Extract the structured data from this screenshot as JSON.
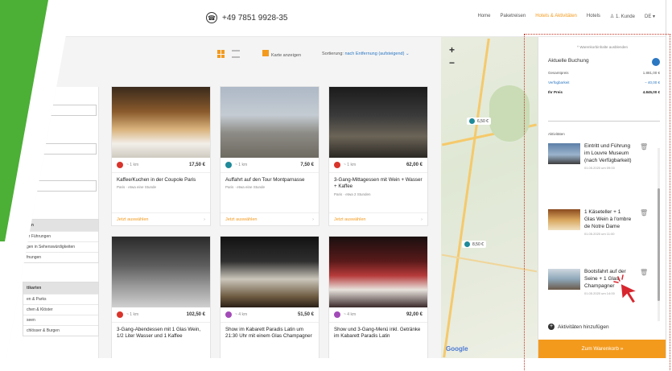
{
  "topbar": {
    "phone": "+49 7851 9928-35",
    "nav": [
      {
        "label": "Home",
        "active": false
      },
      {
        "label": "Paketreisen",
        "active": false
      },
      {
        "label": "Hotels & Aktivitäten",
        "active": true
      },
      {
        "label": "Hotels",
        "active": false
      },
      {
        "label": "1. Kunde",
        "active": false
      },
      {
        "label": "DE ▾",
        "active": false
      }
    ]
  },
  "toolbar": {
    "map_toggle": "Karte anzeigen",
    "sort_label": "Sortierung:",
    "sort_value": "nach Entfernung (aufsteigend) ⌄"
  },
  "sidebar": {
    "section1": {
      "header": "gen",
      "rows": [
        "er Führungen",
        "gen in Sehenswürdigkeiten",
        "fnungen"
      ]
    },
    "section2": {
      "header": "ttkarten",
      "rows": [
        "en & Parks",
        "chen & Klöster",
        "seen",
        "chlösser & Burgen"
      ]
    },
    "option": "ten"
  },
  "cards": [
    {
      "distance": "~ 1 km",
      "price": "17,50 €",
      "title": "Kaffee/Kuchen in der Coupole Paris",
      "sub": "Paris · etwa eine Stunde",
      "cta": "Jetzt auswählen",
      "dot": "#d9342b"
    },
    {
      "distance": "~ 1 km",
      "price": "7,50 €",
      "title": "Auffahrt auf den Tour Montparnasse",
      "sub": "Paris · etwa eine Stunde",
      "cta": "Jetzt auswählen",
      "dot": "#1f8a99"
    },
    {
      "distance": "~ 1 km",
      "price": "62,00 €",
      "title": "3-Gang-Mittagessen mit Wein + Wasser + Kaffee",
      "sub": "Paris · etwa 2 Stunden",
      "cta": "Jetzt auswählen",
      "dot": "#d9342b"
    },
    {
      "distance": "~ 1 km",
      "price": "102,50 €",
      "title": "3-Gang-Abendessen mit 1 Glas Wein, 1/2 Liter Wasser und 1 Kaffee",
      "sub": "",
      "cta": "",
      "dot": "#d9342b"
    },
    {
      "distance": "~ 4 km",
      "price": "51,50 €",
      "title": "Show im Kabarett Paradis Latin um 21:30 Uhr mit einem Glas Champagner",
      "sub": "",
      "cta": "",
      "dot": "#a24bb8"
    },
    {
      "distance": "~ 4 km",
      "price": "92,00 €",
      "title": "Show und 3-Gang-Menü inkl. Getränke im Kabarett Paradis Latin",
      "sub": "",
      "cta": "",
      "dot": "#a24bb8"
    }
  ],
  "map": {
    "zoom_in": "+",
    "zoom_out": "−",
    "pins": [
      "6,50 €",
      "8,50 €"
    ],
    "attribution": "Google"
  },
  "cart": {
    "collapse": "^ Warenkorbinhalte ausblenden",
    "title": "Aktuelle Buchung",
    "lines": [
      {
        "label": "Gesamtpreis",
        "value": "1.881,00 €"
      },
      {
        "label": "Verfügbarkeit",
        "value": "− 40,00 €"
      },
      {
        "label": "Ihr Preis",
        "value": "4.845,00 €"
      }
    ],
    "activities_title": "Aktivitäten",
    "items": [
      {
        "title": "Eintritt und Führung im Louvre Museum (nach Verfügbarkeit)",
        "date": "01.05.2020 um 09:00"
      },
      {
        "title": "1 Käseteller + 1 Glas Wein à l'ombre de Notre Dame",
        "date": "01.05.2020 um 11:00"
      },
      {
        "title": "Bootsfahrt auf der Seine + 1 Glas Champagner",
        "date": "01.05.2020 um 14:00"
      }
    ],
    "add_label": "Aktivitäten hinzufügen",
    "checkout": "Zum Warenkorb »"
  },
  "colors": {
    "accent": "#f39a1d",
    "brand_green": "#4caf36",
    "link": "#2b77c2"
  }
}
